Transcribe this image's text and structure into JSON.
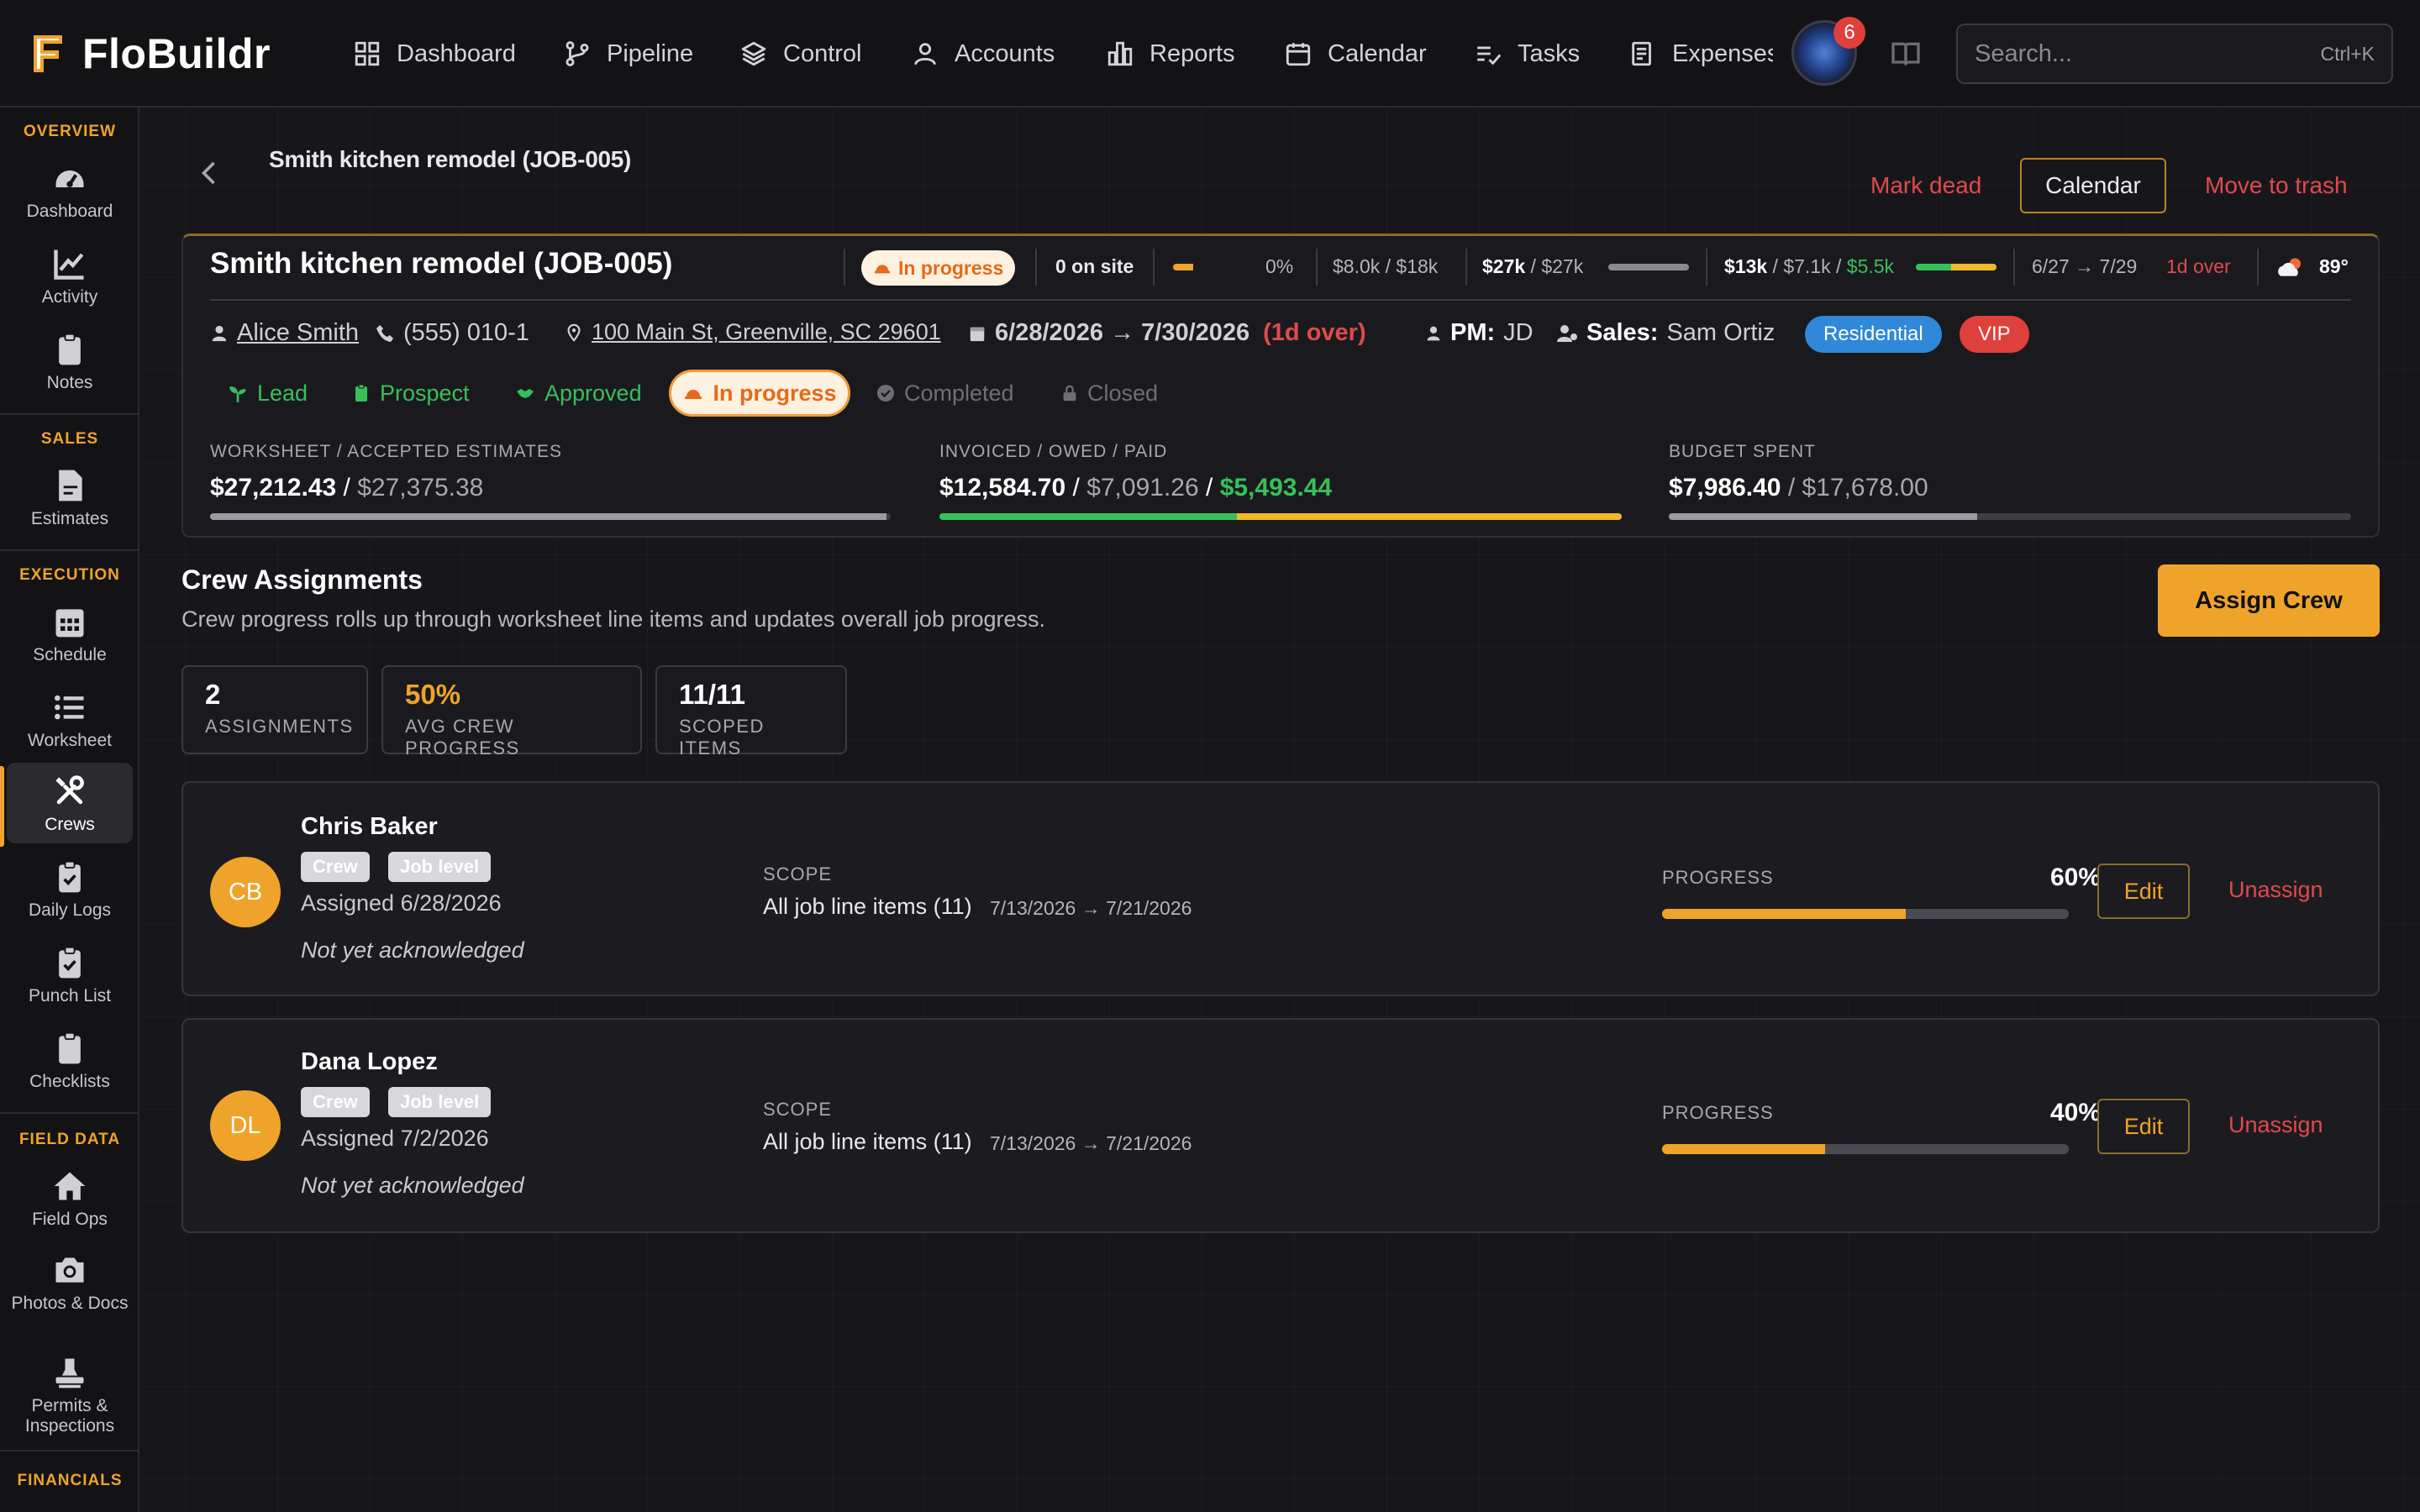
{
  "app": {
    "name": "FloBuildr"
  },
  "nav": [
    {
      "label": "Dashboard",
      "icon": "grid-icon"
    },
    {
      "label": "Pipeline",
      "icon": "branch-icon"
    },
    {
      "label": "Control",
      "icon": "layers-icon"
    },
    {
      "label": "Accounts",
      "icon": "user-icon"
    },
    {
      "label": "Reports",
      "icon": "bar-chart-icon"
    },
    {
      "label": "Calendar",
      "icon": "calendar-icon"
    },
    {
      "label": "Tasks",
      "icon": "checklist-icon"
    },
    {
      "label": "Expenses",
      "icon": "receipt-icon"
    }
  ],
  "notifications": {
    "count": "6"
  },
  "search": {
    "placeholder": "Search...",
    "shortcut": "Ctrl+K"
  },
  "sidebar": {
    "sections": [
      "OVERVIEW",
      "SALES",
      "EXECUTION",
      "FIELD DATA",
      "FINANCIALS"
    ],
    "items": [
      {
        "label": "Dashboard",
        "icon": "gauge-icon"
      },
      {
        "label": "Activity",
        "icon": "line-chart-icon"
      },
      {
        "label": "Notes",
        "icon": "clipboard-icon"
      },
      {
        "label": "Estimates",
        "icon": "document-icon"
      },
      {
        "label": "Schedule",
        "icon": "calendar-grid-icon"
      },
      {
        "label": "Worksheet",
        "icon": "list-icon"
      },
      {
        "label": "Crews",
        "icon": "tools-icon",
        "active": true
      },
      {
        "label": "Daily Logs",
        "icon": "clipboard-check-icon"
      },
      {
        "label": "Punch List",
        "icon": "clipboard-check-icon"
      },
      {
        "label": "Checklists",
        "icon": "clipboard-icon"
      },
      {
        "label": "Field Ops",
        "icon": "home-icon"
      },
      {
        "label": "Photos & Docs",
        "icon": "camera-icon"
      },
      {
        "label": "Permits & Inspections",
        "icon": "stamp-icon"
      }
    ]
  },
  "header": {
    "title": "Smith kitchen remodel (JOB-005)",
    "mark_dead": "Mark dead",
    "calendar": "Calendar",
    "move_to_trash": "Move to trash"
  },
  "job": {
    "title": "Smith kitchen remodel (JOB-005)",
    "status": "In progress",
    "on_site": "0 on site",
    "progress_pct": "0%",
    "progress_value": 0.0,
    "budget_summary": "$8.0k / $18k",
    "worksheet_short": "$27k",
    "estimates_short": "$27k",
    "invoiced_short": "$13k",
    "owed_short": "$7.1k",
    "paid_short": "$5.5k",
    "date_range_short": "6/27 → 7/29",
    "over_short": "1d over",
    "temperature": "89°",
    "client": "Alice Smith",
    "phone": "(555) 010-1",
    "address": "100 Main St, Greenville, SC 29601",
    "date_range": "6/28/2026 → 7/30/2026",
    "date_over": "(1d over)",
    "pm_label": "PM:",
    "pm": "JD",
    "sales_label": "Sales:",
    "sales": "Sam Ortiz",
    "tags": [
      {
        "label": "Residential",
        "color": "#2f88d8"
      },
      {
        "label": "VIP",
        "color": "#e0403b"
      }
    ],
    "stages": [
      {
        "label": "Lead",
        "icon": "sprout-icon"
      },
      {
        "label": "Prospect",
        "icon": "clipboard-icon"
      },
      {
        "label": "Approved",
        "icon": "handshake-icon"
      },
      {
        "label": "In progress",
        "icon": "hardhat-icon"
      },
      {
        "label": "Completed",
        "icon": "check-circle-icon"
      },
      {
        "label": "Closed",
        "icon": "lock-icon"
      }
    ]
  },
  "financials": {
    "worksheet": {
      "label": "WORKSHEET / ACCEPTED ESTIMATES",
      "value": "$27,212.43",
      "total": "$27,375.38",
      "fraction": 0.994
    },
    "invoiced": {
      "label": "INVOICED / OWED / PAID",
      "invoiced": "$12,584.70",
      "owed": "$7,091.26",
      "paid": "$5,493.44",
      "paid_fraction": 0.436,
      "owed_fraction": 0.564
    },
    "budget": {
      "label": "BUDGET SPENT",
      "spent": "$7,986.40",
      "total": "$17,678.00",
      "fraction": 0.452
    }
  },
  "crew_section": {
    "title": "Crew Assignments",
    "description": "Crew progress rolls up through worksheet line items and updates overall job progress.",
    "assign_button": "Assign Crew",
    "stats": [
      {
        "value": "2",
        "label": "ASSIGNMENTS"
      },
      {
        "value": "50%",
        "label": "AVG CREW PROGRESS"
      },
      {
        "value": "11/11",
        "label": "SCOPED ITEMS"
      }
    ],
    "assignments": [
      {
        "initials": "CB",
        "name": "Chris Baker",
        "chips": [
          "Crew",
          "Job level"
        ],
        "assigned": "Assigned 6/28/2026",
        "ack": "Not yet acknowledged",
        "scope_label": "SCOPE",
        "scope": "All job line items (11)",
        "dates": "7/13/2026 → 7/21/2026",
        "progress_label": "PROGRESS",
        "progress_text": "60%",
        "progress": 0.6,
        "edit": "Edit",
        "unassign": "Unassign"
      },
      {
        "initials": "DL",
        "name": "Dana Lopez",
        "chips": [
          "Crew",
          "Job level"
        ],
        "assigned": "Assigned 7/2/2026",
        "ack": "Not yet acknowledged",
        "scope_label": "SCOPE",
        "scope": "All job line items (11)",
        "dates": "7/13/2026 → 7/21/2026",
        "progress_label": "PROGRESS",
        "progress_text": "40%",
        "progress": 0.4,
        "edit": "Edit",
        "unassign": "Unassign"
      }
    ]
  },
  "colors": {
    "accent": "#f0a32a",
    "danger": "#e04a4a",
    "success": "#37c05a",
    "in_progress": "#e56a18"
  }
}
